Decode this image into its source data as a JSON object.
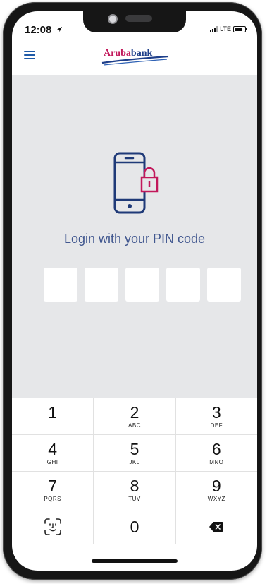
{
  "status_bar": {
    "time": "12:08",
    "network": "LTE"
  },
  "app_bar": {
    "brand_prefix": "Aruba",
    "brand_suffix": "bank"
  },
  "login": {
    "title": "Login with your PIN code",
    "pin_length": 5
  },
  "keypad": {
    "rows": [
      [
        {
          "digit": "1",
          "letters": ""
        },
        {
          "digit": "2",
          "letters": "ABC"
        },
        {
          "digit": "3",
          "letters": "DEF"
        }
      ],
      [
        {
          "digit": "4",
          "letters": "GHI"
        },
        {
          "digit": "5",
          "letters": "JKL"
        },
        {
          "digit": "6",
          "letters": "MNO"
        }
      ],
      [
        {
          "digit": "7",
          "letters": "PQRS"
        },
        {
          "digit": "8",
          "letters": "TUV"
        },
        {
          "digit": "9",
          "letters": "WXYZ"
        }
      ]
    ],
    "zero": "0",
    "faceid_icon": "face-id-icon",
    "delete_icon": "backspace-icon"
  },
  "colors": {
    "brand_blue": "#1e3f8a",
    "brand_pink": "#c2185b",
    "title_blue": "#41578f",
    "content_bg": "#e6e7e9"
  }
}
